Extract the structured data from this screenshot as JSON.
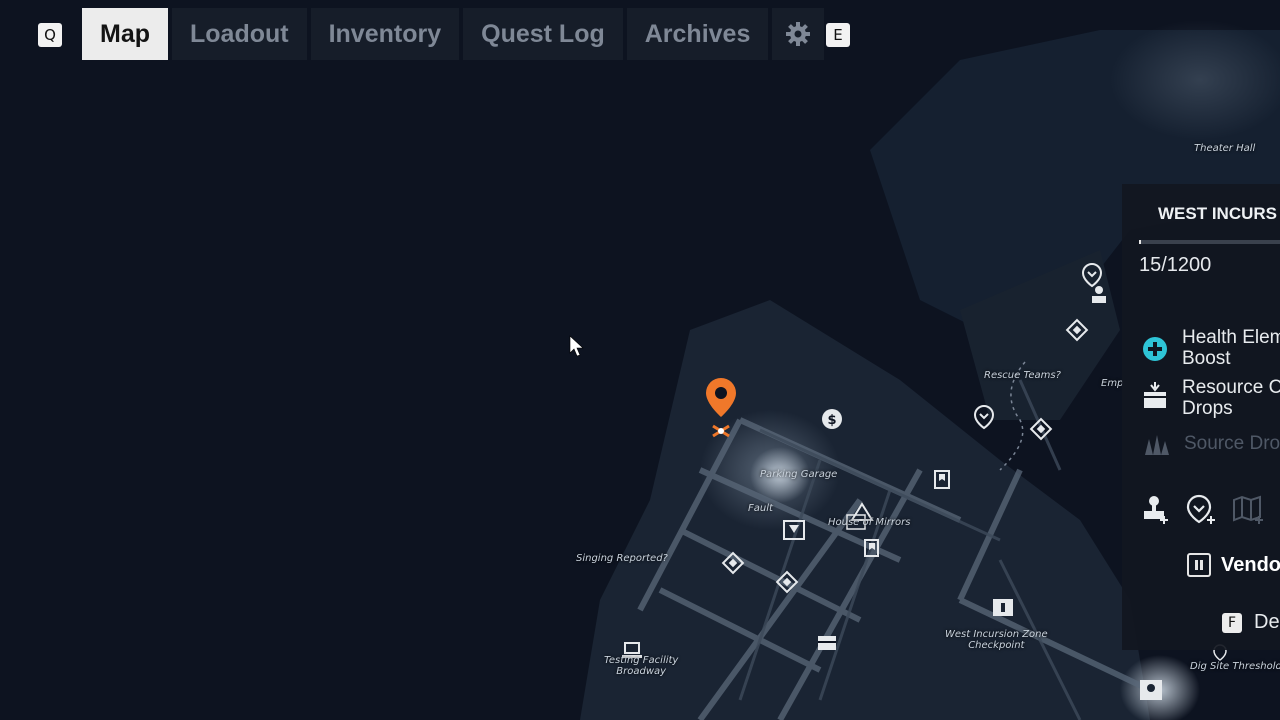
{
  "keys": {
    "left": "Q",
    "right": "E"
  },
  "tabs": [
    {
      "label": "Map",
      "active": true
    },
    {
      "label": "Loadout",
      "active": false
    },
    {
      "label": "Inventory",
      "active": false
    },
    {
      "label": "Quest Log",
      "active": false
    },
    {
      "label": "Archives",
      "active": false
    }
  ],
  "settings_icon": "gear-icon",
  "map_labels": {
    "theater_hall": "Theater Hall",
    "rescue_teams": "Rescue Teams?",
    "emp": "Emp",
    "parking_garage": "Parking Garage",
    "fault": "Fault",
    "house_of_mirrors": "House of Mirrors",
    "singing_reported": "Singing Reported?",
    "testing_facility": "Testing Facility",
    "broadway": "Broadway",
    "checkpoint_1": "West Incursion Zone",
    "checkpoint_2": "Checkpoint",
    "dig_site": "Dig Site Threshold"
  },
  "panel": {
    "title": "WEST INCURS",
    "progress_text": "15/1200",
    "progress_value": 15,
    "progress_max": 1200,
    "rewards": [
      {
        "line1": "Health Elem",
        "line2": "Boost",
        "icon": "health-plus-icon"
      },
      {
        "line1": "Resource C",
        "line2": "Drops",
        "icon": "resource-crate-icon"
      },
      {
        "line1": "Source Dro",
        "line2": "",
        "icon": "source-crystal-icon"
      }
    ],
    "actions": [
      "person-add-icon",
      "pin-add-icon",
      "map-add-icon"
    ],
    "vendor_label": "Vendo",
    "detail_key": "F",
    "detail_label": "De"
  },
  "colors": {
    "accent_orange": "#f0782a",
    "health_cyan": "#2ec4d6",
    "background": "#0d1320"
  }
}
